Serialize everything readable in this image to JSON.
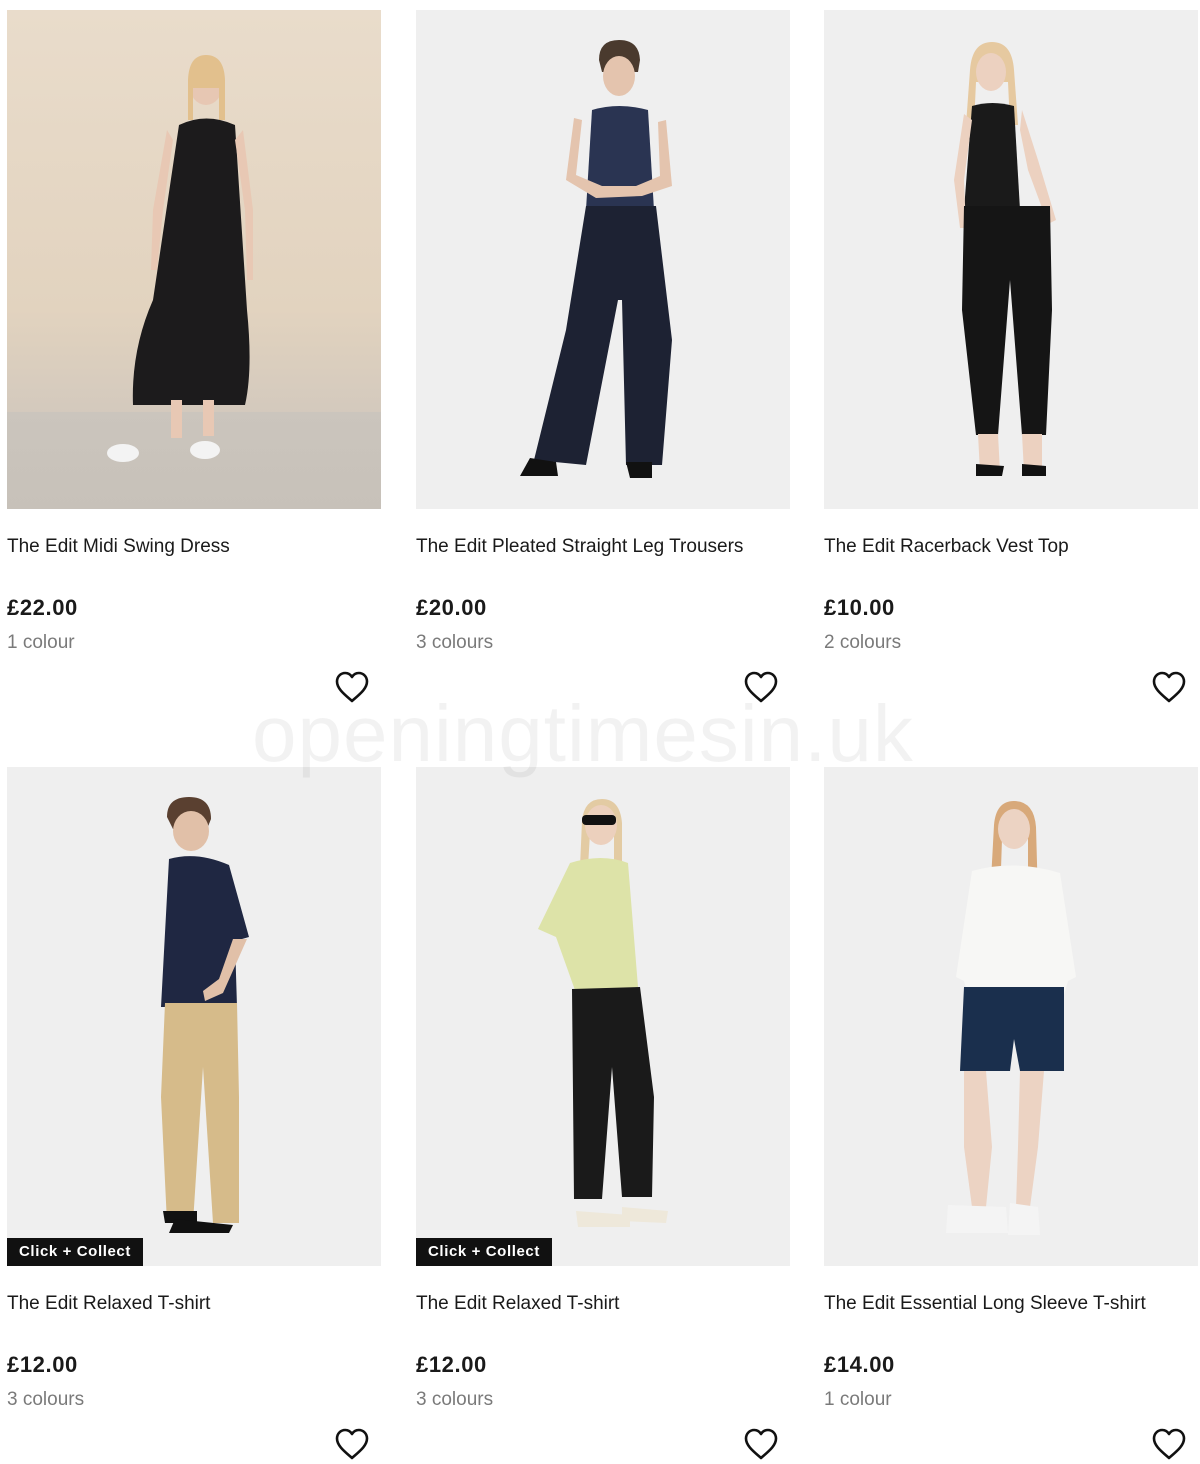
{
  "products": [
    {
      "name": "The Edit Midi Swing Dress",
      "price": "£22.00",
      "colours": "1 colour",
      "badge": "",
      "wishlist_icon": "heart-outline-icon"
    },
    {
      "name": "The Edit Pleated Straight Leg Trousers",
      "price": "£20.00",
      "colours": "3 colours",
      "badge": "",
      "wishlist_icon": "heart-outline-icon"
    },
    {
      "name": "The Edit Racerback Vest Top",
      "price": "£10.00",
      "colours": "2 colours",
      "badge": "",
      "wishlist_icon": "heart-outline-icon"
    },
    {
      "name": "The Edit Relaxed T-shirt",
      "price": "£12.00",
      "colours": "3 colours",
      "badge": "Click + Collect",
      "wishlist_icon": "heart-outline-icon"
    },
    {
      "name": "The Edit Relaxed T-shirt",
      "price": "£12.00",
      "colours": "3 colours",
      "badge": "Click + Collect",
      "wishlist_icon": "heart-outline-icon"
    },
    {
      "name": "The Edit Essential Long Sleeve T-shirt",
      "price": "£14.00",
      "colours": "1 colour",
      "badge": "",
      "wishlist_icon": "heart-outline-icon"
    }
  ],
  "watermark": "openingtimesin.uk",
  "colors": {
    "text": "#1a1a1a",
    "muted": "#7a7a7a",
    "badge_bg": "#111111",
    "image_bg": "#efefef",
    "beige_bg": "#e2d3bf"
  }
}
